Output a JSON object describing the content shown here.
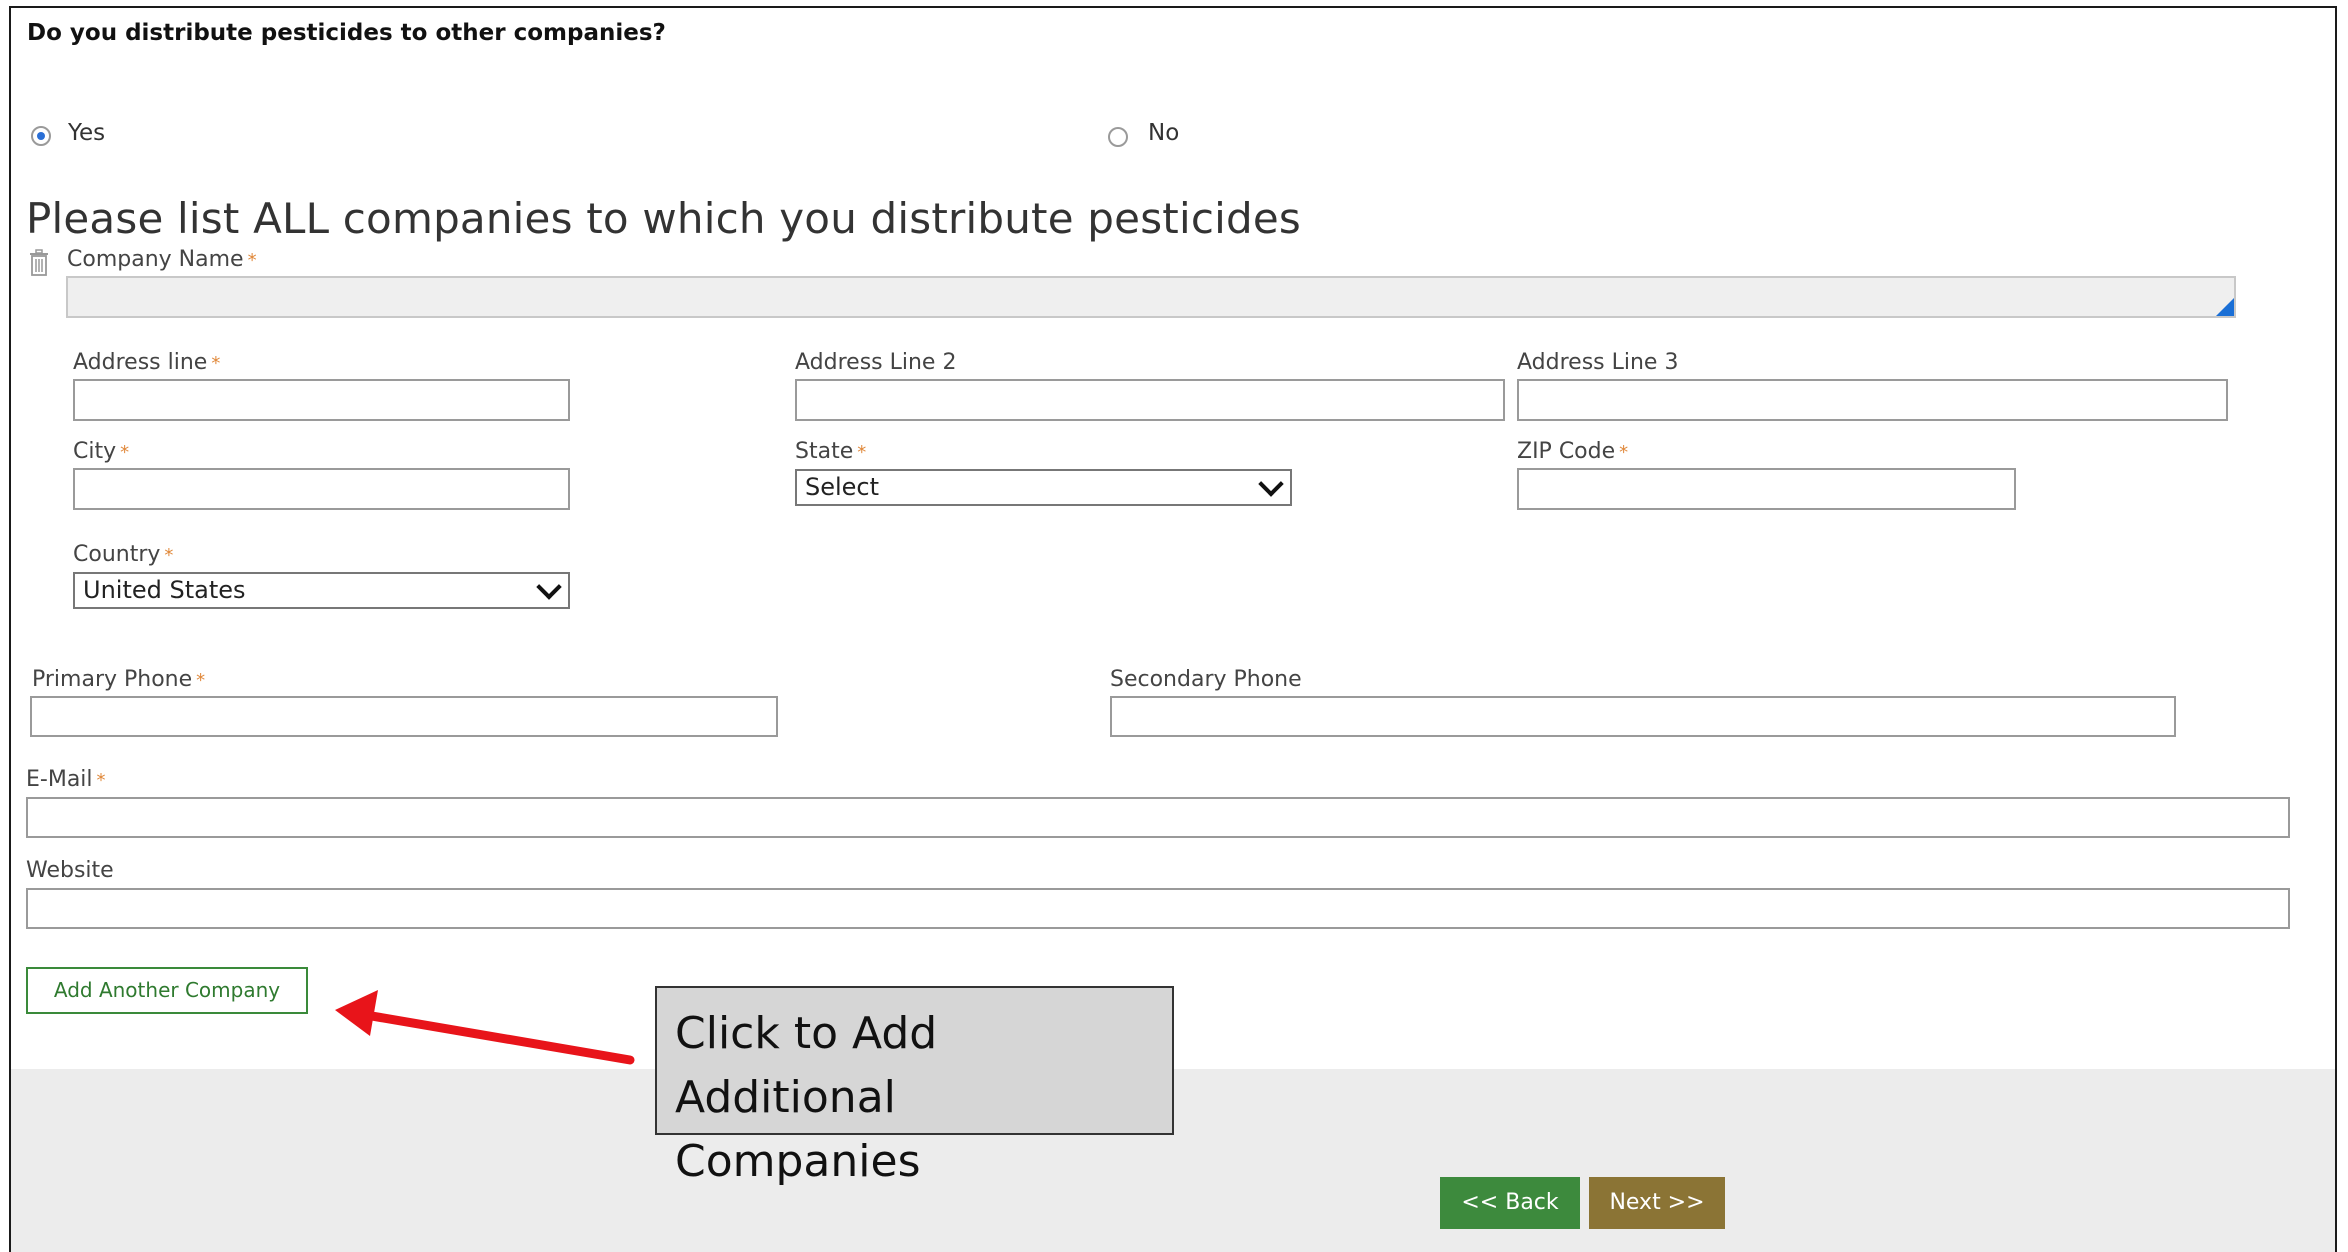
{
  "question": {
    "text": "Do you distribute pesticides to other companies?"
  },
  "radios": {
    "yes_label": "Yes",
    "no_label": "No"
  },
  "section": {
    "heading": "Please list ALL companies to which you distribute pesticides"
  },
  "fields": {
    "company_name": "Company Name",
    "address_line": "Address line",
    "address_line2": "Address Line 2",
    "address_line3": "Address Line 3",
    "city": "City",
    "state": "State",
    "zip": "ZIP Code",
    "country": "Country",
    "primary_phone": "Primary Phone",
    "secondary_phone": "Secondary Phone",
    "email": "E-Mail",
    "website": "Website",
    "required_mark": "*"
  },
  "selects": {
    "state_value": "Select",
    "country_value": "United States"
  },
  "buttons": {
    "add_company": "Add Another Company",
    "back": "<< Back",
    "next": "Next >>"
  },
  "callout": {
    "line1": "Click to Add",
    "line2": "Additional Companies"
  },
  "colors": {
    "accent_green": "#3d8a3d",
    "accent_gold": "#8b7435",
    "required": "#e0883a",
    "arrow": "#e8141a",
    "radio_selected": "#2a6fd6"
  },
  "icons": {
    "delete": "trash-icon",
    "dropdown": "chevron-down-icon",
    "resize": "resize-handle-icon"
  }
}
